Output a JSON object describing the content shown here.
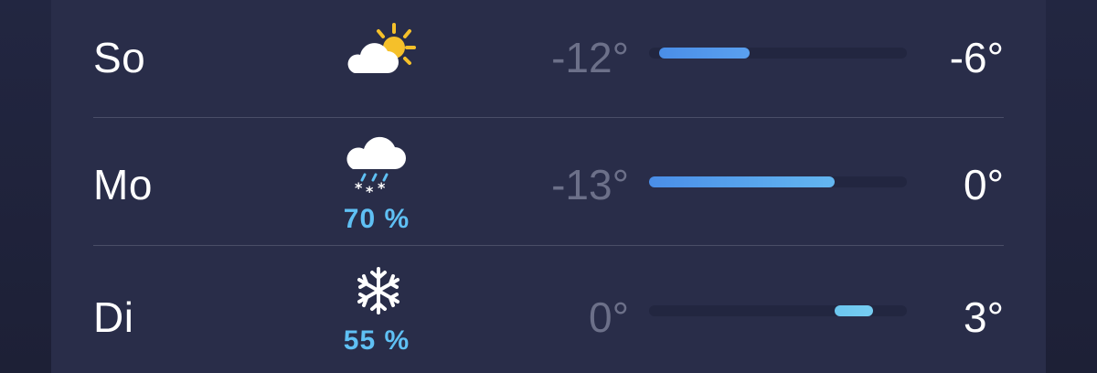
{
  "forecast": [
    {
      "day": "So",
      "icon": "partly-cloudy-sun-icon",
      "precip": "",
      "low": "-12°",
      "high": "-6°",
      "range": {
        "start": 0.04,
        "end": 0.39
      },
      "bar_colors": [
        "#4a8ee8",
        "#5aa0ef"
      ]
    },
    {
      "day": "Mo",
      "icon": "cloud-snow-icon",
      "precip": "70 %",
      "low": "-13°",
      "high": "0°",
      "range": {
        "start": 0.0,
        "end": 0.72
      },
      "bar_colors": [
        "#4a8ee8",
        "#63b6f0"
      ]
    },
    {
      "day": "Di",
      "icon": "snowflake-icon",
      "precip": "55 %",
      "low": "0°",
      "high": "3°",
      "range": {
        "start": 0.72,
        "end": 0.87
      },
      "bar_colors": [
        "#6cc6ef",
        "#76cdf2"
      ]
    }
  ],
  "colors": {
    "panel_bg": "#292d49",
    "precip_text": "#5fc0f4",
    "low_text": "#6c7089",
    "high_text": "#ffffff",
    "track": "#222640"
  }
}
